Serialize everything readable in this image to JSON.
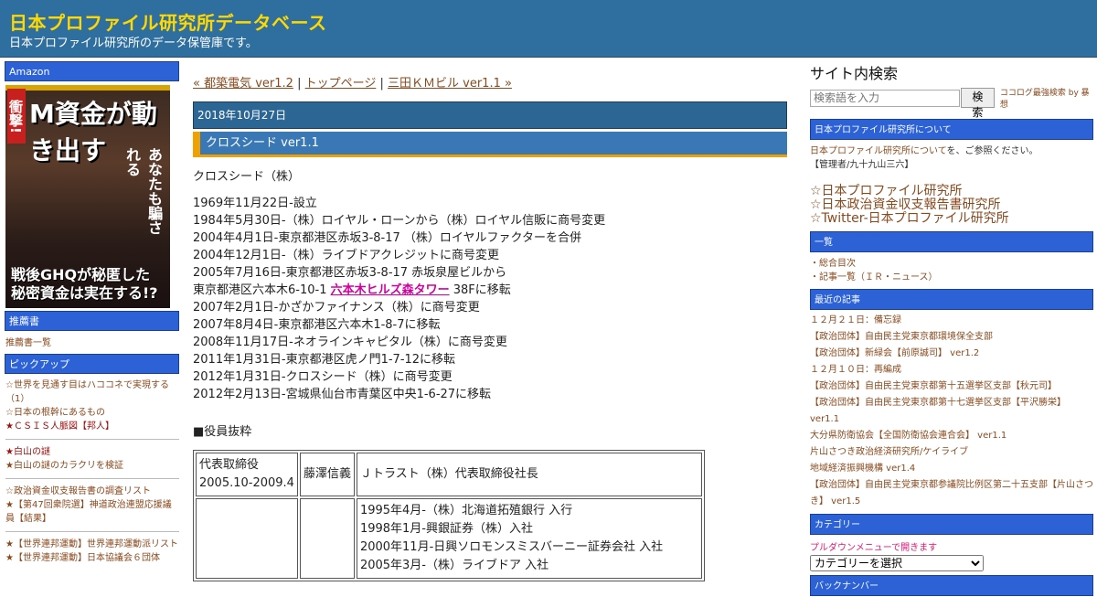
{
  "header": {
    "title": "日本プロファイル研究所データベース",
    "subtitle": "日本プロファイル研究所のデータ保管庫です。"
  },
  "left": {
    "amazon_label": "Amazon",
    "book": {
      "band": "衝撃!",
      "headline": "M資金が動き出す",
      "vertical": "あなたも騙される",
      "bottom": "戦後GHQが秘匿した秘密資金は実在する!?"
    },
    "recommend_label": "推薦書",
    "recommend_link": "推薦書一覧",
    "pickup_label": "ピックアップ",
    "pickup_group1": [
      "☆世界を見通す目はハココネで実現する（1）",
      "☆日本の根幹にあるもの",
      "★ＣＳＩＳ人脈図【邦人】"
    ],
    "pickup_group2": [
      "★白山の謎",
      "★白山の謎のカラクリを検証"
    ],
    "pickup_group3": [
      "☆政治資金収支報告書の調査リスト",
      "★【第47回衆院選】神道政治連盟応援議員【結果】"
    ],
    "pickup_group4": [
      "★【世界連邦運動】世界連邦運動派リスト",
      "★【世界連邦運動】日本協議会６団体"
    ]
  },
  "main": {
    "nav": {
      "prev": "« 都築電気 ver1.2",
      "sep1": " | ",
      "top": "トップページ",
      "sep2": " | ",
      "next": "三田ＫＭビル ver1.1 »"
    },
    "date": "2018年10月27日",
    "post_title": "クロスシード ver1.1",
    "company": "クロスシード（株）",
    "history": [
      "1969年11月22日-設立",
      "1984年5月30日-（株）ロイヤル・ローンから（株）ロイヤル信販に商号変更",
      "2004年4月1日-東京都港区赤坂3-8-17 （株）ロイヤルファクターを合併",
      "2004年12月1日-（株）ライブドアクレジットに商号変更",
      "2005年7月16日-東京都港区赤坂3-8-17 赤坂泉屋ビルから"
    ],
    "move_prefix": "東京都港区六本木6-10-1 ",
    "move_link": "六本木ヒルズ森タワー",
    "move_suffix": " 38Fに移転",
    "history2": [
      "2007年2月1日-かざかファイナンス（株）に商号変更",
      "2007年8月4日-東京都港区六本木1-8-7に移転",
      "2008年11月17日-ネオラインキャピタル（株）に商号変更",
      "2011年1月31日-東京都港区虎ノ門1-7-12に移転",
      "2012年1月31日-クロスシード（株）に商号変更",
      "2012年2月13日-宮城県仙台市青葉区中央1-6-27に移転"
    ],
    "officers_heading": "■役員抜粋",
    "officers": {
      "row1_role": "代表取締役",
      "row1_period": "2005.10-2009.4",
      "row1_name": "藤澤信義",
      "row1_desc": "Ｊトラスト（株）代表取締役社長",
      "row2_desc": [
        "1995年4月-（株）北海道拓殖銀行 入行",
        "1998年1月-興銀証券（株）入社",
        "2000年11月-日興ソロモンスミスバーニー証券会社 入社",
        "2005年3月-（株）ライブドア 入社"
      ]
    }
  },
  "right": {
    "search_title": "サイト内検索",
    "search_placeholder": "検索語を入力",
    "search_button": "検索",
    "search_credit": "ココログ最強検索 by 暴想",
    "about_label": "日本プロファイル研究所について",
    "about_link": "日本プロファイル研究所について",
    "about_text": "を、ご参照ください。",
    "admin": "【管理者/九十九山三六】",
    "big_links": [
      "☆日本プロファイル研究所",
      "☆日本政治資金収支報告書研究所",
      "☆Twitter-日本プロファイル研究所"
    ],
    "list_label": "一覧",
    "list_items": [
      "・総合目次",
      "・記事一覧（ＩＲ・ニュース）"
    ],
    "recent_label": "最近の記事",
    "recent": [
      "１２月２１日：備忘録",
      "【政治団体】自由民主党東京都環境保全支部",
      "【政治団体】新緑会【前原誠司】 ver1.2",
      "１２月１０日：再編成",
      "【政治団体】自由民主党東京都第十五選挙区支部【秋元司】",
      "【政治団体】自由民主党東京都第十七選挙区支部【平沢勝栄】 ver1.1",
      "大分県防衛協会【全国防衛協会連合会】 ver1.1",
      "片山さつき政治経済研究所/ケイライブ",
      "地域経済振興機構 ver1.4",
      "【政治団体】自由民主党東京都参議院比例区第二十五支部【片山さつき】 ver1.5"
    ],
    "category_label": "カテゴリー",
    "category_hint": "プルダウンメニューで開きます",
    "category_select": "カテゴリーを選択",
    "backnumber_label": "バックナンバー"
  },
  "colors": {
    "header_bg": "#2f6fa0",
    "title_yellow": "#ffd800",
    "sidebar_bar": "#2c62d6",
    "link_brown": "#8a4a1e",
    "highlight_magenta": "#d000a0",
    "accent_orange": "#f0a000"
  }
}
